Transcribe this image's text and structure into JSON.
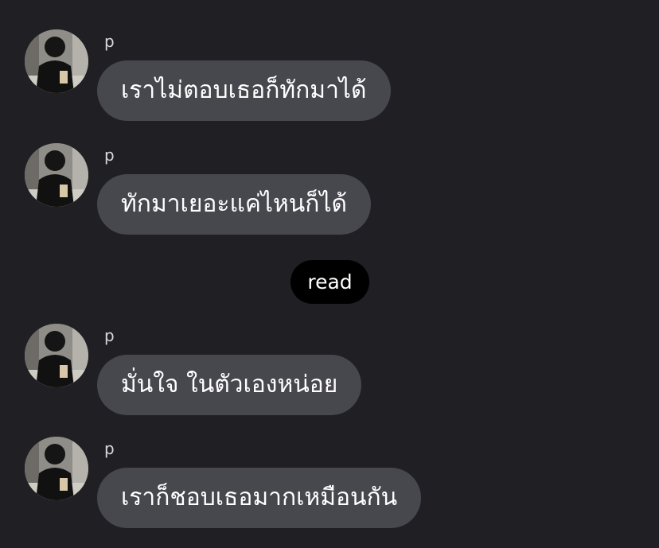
{
  "messages": [
    {
      "sender": "p",
      "text": "เราไม่ตอบเธอก็ทักมาได้"
    },
    {
      "sender": "p",
      "text": "ทักมาเยอะแค่ไหนก็ได้"
    },
    {
      "sender": "p",
      "text": "มั่นใจ ในตัวเองหน่อย"
    },
    {
      "sender": "p",
      "text": "เราก็ชอบเธอมากเหมือนกัน"
    }
  ],
  "read_receipt": "read",
  "colors": {
    "background": "#1f1f24",
    "bubble": "#47474e",
    "read_pill": "#000000"
  }
}
